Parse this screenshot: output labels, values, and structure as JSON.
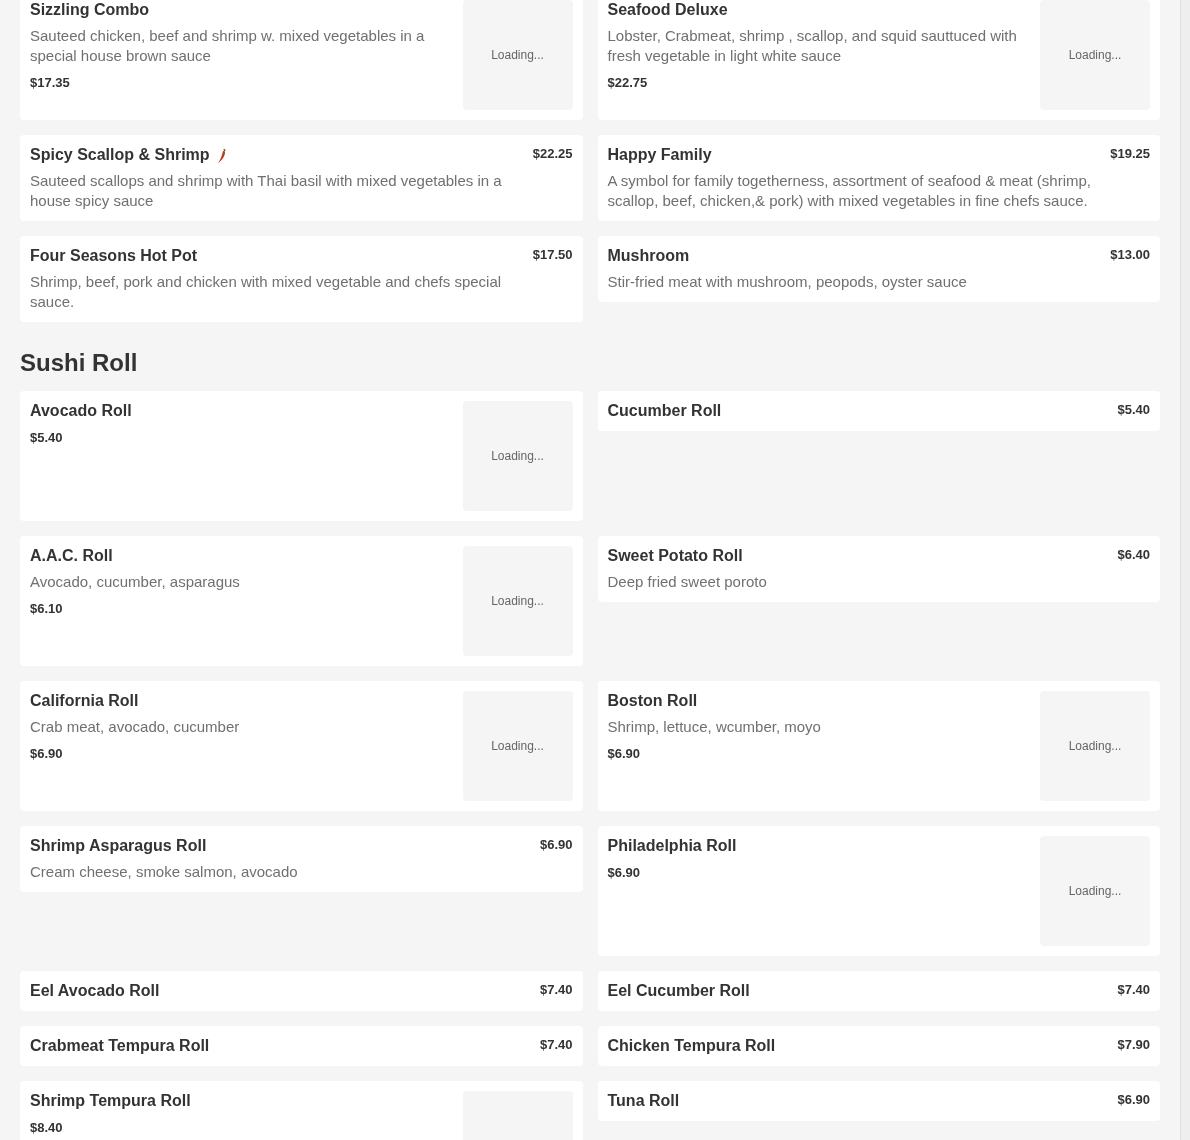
{
  "sections": [
    {
      "items": [
        {
          "name": "Sizzling Combo",
          "description": "Sauteed chicken, beef and shrimp w. mixed vegetables in a special house brown sauce",
          "price": "$17.35",
          "image_label": "Loading..."
        },
        {
          "name": "Seafood Deluxe",
          "description": "Lobster, Crabmeat, shrimp , scallop, and squid sauttuced with fresh vegetable in light white sauce",
          "price": "$22.75",
          "image_label": "Loading..."
        },
        {
          "name": "Spicy Scallop & Shrimp",
          "spicy": true,
          "description": "Sauteed scallops and shrimp with Thai basil with mixed vegetables in a house spicy sauce",
          "price": "$22.25"
        },
        {
          "name": "Happy Family",
          "description": "A symbol for family togetherness, assortment of seafood & meat (shrimp, scallop, beef, chicken,& pork) with mixed vegetables in fine chefs sauce.",
          "price": "$19.25"
        },
        {
          "name": "Four Seasons Hot Pot",
          "description": "Shrimp, beef, pork and chicken with mixed vegetable and chefs special sauce.",
          "price": "$17.50"
        },
        {
          "name": "Mushroom",
          "description": "Stir-fried meat with mushroom, peopods, oyster sauce",
          "price": "$13.00"
        }
      ]
    },
    {
      "title": "Sushi Roll",
      "items": [
        {
          "name": "Avocado Roll",
          "price": "$5.40",
          "image_label": "Loading..."
        },
        {
          "name": "Cucumber Roll",
          "price": "$5.40"
        },
        {
          "name": "A.A.C. Roll",
          "description": "Avocado, cucumber, asparagus",
          "price": "$6.10",
          "image_label": "Loading..."
        },
        {
          "name": "Sweet Potato Roll",
          "description": "Deep fried sweet poroto",
          "price": "$6.40"
        },
        {
          "name": "California Roll",
          "description": "Crab meat, avocado, cucumber",
          "price": "$6.90",
          "image_label": "Loading..."
        },
        {
          "name": "Boston Roll",
          "description": "Shrimp, lettuce, wcumber, moyo",
          "price": "$6.90",
          "image_label": "Loading..."
        },
        {
          "name": "Shrimp Asparagus Roll",
          "description": "Cream cheese, smoke salmon, avocado",
          "price": "$6.90"
        },
        {
          "name": "Philadelphia Roll",
          "price": "$6.90",
          "image_label": "Loading..."
        },
        {
          "name": "Eel Avocado Roll",
          "price": "$7.40"
        },
        {
          "name": "Eel Cucumber Roll",
          "price": "$7.40"
        },
        {
          "name": "Crabmeat Tempura Roll",
          "price": "$7.40"
        },
        {
          "name": "Chicken Tempura Roll",
          "price": "$7.90"
        },
        {
          "name": "Shrimp Tempura Roll",
          "price": "$8.40",
          "has_image": true
        },
        {
          "name": "Tuna Roll",
          "price": "$6.90"
        }
      ]
    }
  ]
}
